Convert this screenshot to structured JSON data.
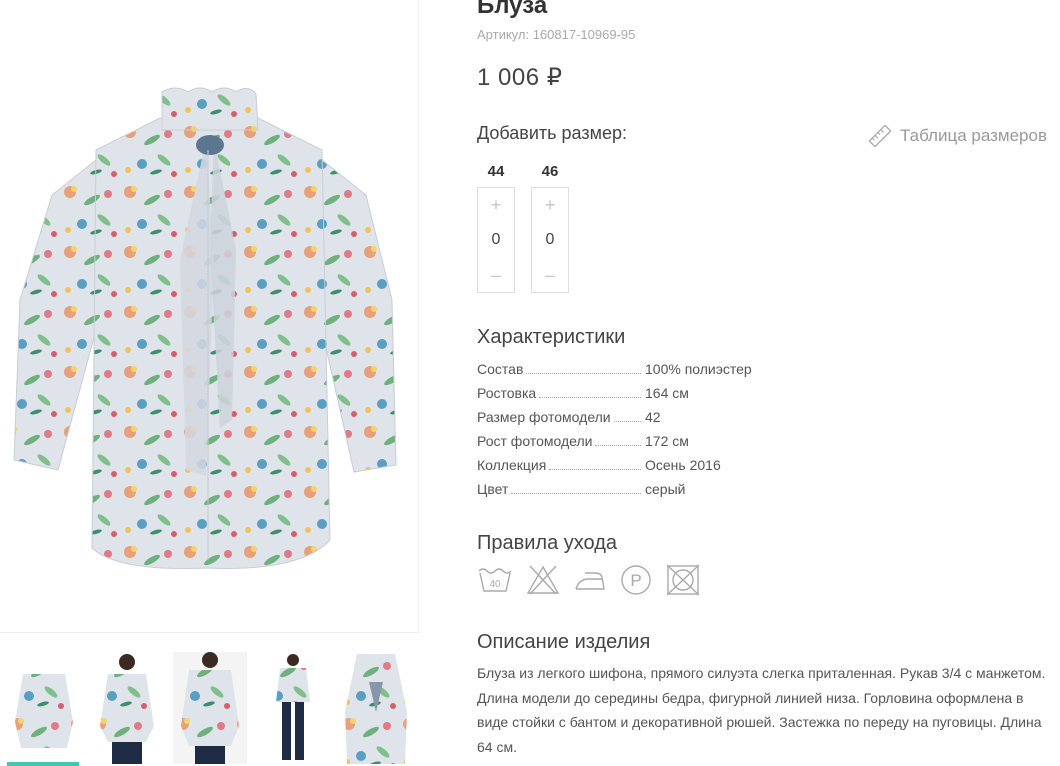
{
  "product": {
    "title": "Блуза",
    "sku": "Артикул: 160817-10969-95",
    "price": "1 006 ₽"
  },
  "sizes": {
    "label": "Добавить размер:",
    "table_link": "Таблица размеров",
    "items": [
      {
        "size": "44",
        "qty": "0",
        "plus": "+",
        "minus": "–"
      },
      {
        "size": "46",
        "qty": "0",
        "plus": "+",
        "minus": "–"
      }
    ]
  },
  "specs": {
    "heading": "Характеристики",
    "rows": [
      {
        "key": "Состав",
        "value": "100% полиэстер"
      },
      {
        "key": "Ростовка",
        "value": "164 см"
      },
      {
        "key": "Размер фотомодели",
        "value": "42"
      },
      {
        "key": "Рост фотомодели",
        "value": "172 см"
      },
      {
        "key": "Коллекция",
        "value": "Осень 2016"
      },
      {
        "key": "Цвет",
        "value": "серый"
      }
    ]
  },
  "care": {
    "heading": "Правила ухода",
    "icons": [
      "wash-40-icon",
      "no-bleach-icon",
      "iron-low-icon",
      "dry-clean-p-icon",
      "no-tumble-dry-icon"
    ],
    "wash_temp": "40",
    "dryclean_letter": "P"
  },
  "description": {
    "heading": "Описание изделия",
    "text": "Блуза из легкого шифона, прямого силуэта слегка приталенная. Рукав 3/4 с манжетом. Длина модели до середины бедра, фигурной линией низа. Горловина оформлена в виде стойки с бантом и декоративной рюшей. Застежка по переду на пуговицы. Длина 64 см."
  },
  "gallery": {
    "thumb_count": 5,
    "active_index": 0
  },
  "colors": {
    "accent": "#3ec9b4",
    "fabric": "#dfe3ea"
  }
}
